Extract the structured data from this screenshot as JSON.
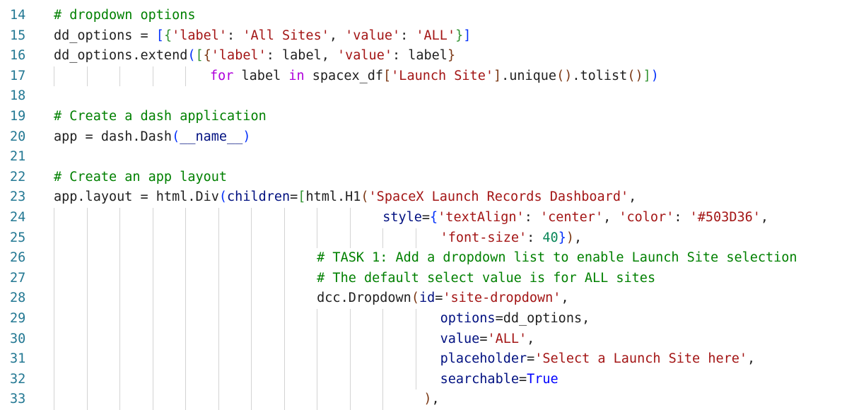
{
  "lines": [
    {
      "n": "14",
      "indent": 0,
      "guides": 0,
      "tokens": [
        [
          "comment",
          "# dropdown options"
        ]
      ]
    },
    {
      "n": "15",
      "indent": 0,
      "guides": 0,
      "tokens": [
        [
          "default",
          "dd_options = "
        ],
        [
          "b1",
          "["
        ],
        [
          "b2",
          "{"
        ],
        [
          "string",
          "'label'"
        ],
        [
          "default",
          ": "
        ],
        [
          "string",
          "'All Sites'"
        ],
        [
          "default",
          ", "
        ],
        [
          "string",
          "'value'"
        ],
        [
          "default",
          ": "
        ],
        [
          "string",
          "'ALL'"
        ],
        [
          "b2",
          "}"
        ],
        [
          "b1",
          "]"
        ]
      ]
    },
    {
      "n": "16",
      "indent": 0,
      "guides": 0,
      "tokens": [
        [
          "default",
          "dd_options.extend"
        ],
        [
          "b1",
          "("
        ],
        [
          "b2",
          "["
        ],
        [
          "b3",
          "{"
        ],
        [
          "string",
          "'label'"
        ],
        [
          "default",
          ": label, "
        ],
        [
          "string",
          "'value'"
        ],
        [
          "default",
          ": label"
        ],
        [
          "b3",
          "}"
        ]
      ]
    },
    {
      "n": "17",
      "indent": 19,
      "guides": 5,
      "tokens": [
        [
          "keyword",
          "for"
        ],
        [
          "default",
          " label "
        ],
        [
          "keyword",
          "in"
        ],
        [
          "default",
          " spacex_df"
        ],
        [
          "b3",
          "["
        ],
        [
          "string",
          "'Launch Site'"
        ],
        [
          "b3",
          "]"
        ],
        [
          "default",
          ".unique"
        ],
        [
          "b3",
          "()"
        ],
        [
          "default",
          ".tolist"
        ],
        [
          "b3",
          "()"
        ],
        [
          "b2",
          "]"
        ],
        [
          "b1",
          ")"
        ]
      ]
    },
    {
      "n": "18",
      "indent": 0,
      "guides": 0,
      "tokens": []
    },
    {
      "n": "19",
      "indent": 0,
      "guides": 0,
      "tokens": [
        [
          "comment",
          "# Create a dash application"
        ]
      ]
    },
    {
      "n": "20",
      "indent": 0,
      "guides": 0,
      "tokens": [
        [
          "default",
          "app = dash.Dash"
        ],
        [
          "b1",
          "("
        ],
        [
          "var",
          "__name__"
        ],
        [
          "b1",
          ")"
        ]
      ]
    },
    {
      "n": "21",
      "indent": 0,
      "guides": 0,
      "tokens": []
    },
    {
      "n": "22",
      "indent": 0,
      "guides": 0,
      "tokens": [
        [
          "comment",
          "# Create an app layout"
        ]
      ]
    },
    {
      "n": "23",
      "indent": 0,
      "guides": 0,
      "tokens": [
        [
          "default",
          "app.layout = html.Div"
        ],
        [
          "b1",
          "("
        ],
        [
          "var",
          "children"
        ],
        [
          "default",
          "="
        ],
        [
          "b2",
          "["
        ],
        [
          "default",
          "html.H1"
        ],
        [
          "b3",
          "("
        ],
        [
          "string",
          "'SpaceX Launch Records Dashboard'"
        ],
        [
          "default",
          ","
        ]
      ]
    },
    {
      "n": "24",
      "indent": 40,
      "guides": 10,
      "tokens": [
        [
          "var",
          "style"
        ],
        [
          "default",
          "="
        ],
        [
          "b1",
          "{"
        ],
        [
          "string",
          "'textAlign'"
        ],
        [
          "default",
          ": "
        ],
        [
          "string",
          "'center'"
        ],
        [
          "default",
          ", "
        ],
        [
          "string",
          "'color'"
        ],
        [
          "default",
          ": "
        ],
        [
          "string",
          "'#503D36'"
        ],
        [
          "default",
          ","
        ]
      ]
    },
    {
      "n": "25",
      "indent": 47,
      "guides": 12,
      "tokens": [
        [
          "string",
          "'font-size'"
        ],
        [
          "default",
          ": "
        ],
        [
          "number",
          "40"
        ],
        [
          "b1",
          "}"
        ],
        [
          "b3",
          ")"
        ],
        [
          "default",
          ","
        ]
      ]
    },
    {
      "n": "26",
      "indent": 32,
      "guides": 8,
      "tokens": [
        [
          "comment",
          "# TASK 1: Add a dropdown list to enable Launch Site selection"
        ]
      ]
    },
    {
      "n": "27",
      "indent": 32,
      "guides": 8,
      "tokens": [
        [
          "comment",
          "# The default select value is for ALL sites"
        ]
      ]
    },
    {
      "n": "28",
      "indent": 32,
      "guides": 8,
      "tokens": [
        [
          "default",
          "dcc.Dropdown"
        ],
        [
          "b3",
          "("
        ],
        [
          "var",
          "id"
        ],
        [
          "default",
          "="
        ],
        [
          "string",
          "'site-dropdown'"
        ],
        [
          "default",
          ","
        ]
      ]
    },
    {
      "n": "29",
      "indent": 47,
      "guides": 12,
      "tokens": [
        [
          "var",
          "options"
        ],
        [
          "default",
          "=dd_options,"
        ]
      ]
    },
    {
      "n": "30",
      "indent": 47,
      "guides": 12,
      "tokens": [
        [
          "var",
          "value"
        ],
        [
          "default",
          "="
        ],
        [
          "string",
          "'ALL'"
        ],
        [
          "default",
          ","
        ]
      ]
    },
    {
      "n": "31",
      "indent": 47,
      "guides": 12,
      "tokens": [
        [
          "var",
          "placeholder"
        ],
        [
          "default",
          "="
        ],
        [
          "string",
          "'Select a Launch Site here'"
        ],
        [
          "default",
          ","
        ]
      ]
    },
    {
      "n": "32",
      "indent": 47,
      "guides": 12,
      "tokens": [
        [
          "var",
          "searchable"
        ],
        [
          "default",
          "="
        ],
        [
          "const",
          "True"
        ]
      ]
    },
    {
      "n": "33",
      "indent": 45,
      "guides": 11,
      "tokens": [
        [
          "b3",
          ")"
        ],
        [
          "default",
          ","
        ]
      ]
    }
  ]
}
